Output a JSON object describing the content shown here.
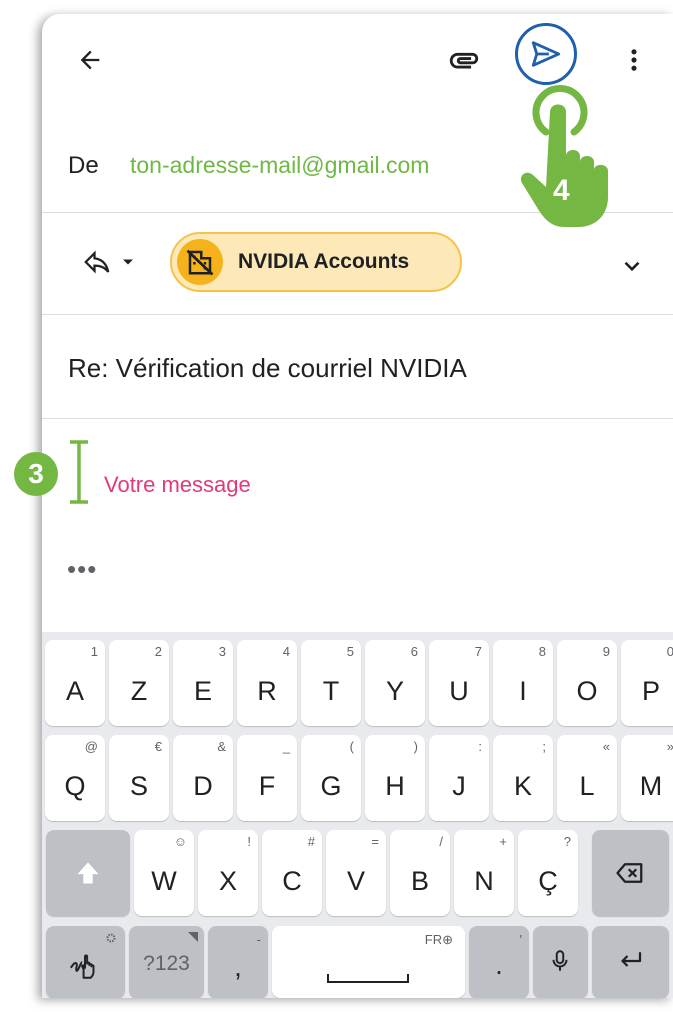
{
  "compose": {
    "from_label": "De",
    "from_value": "ton-adresse-mail@gmail.com",
    "recipient_chip": "NVIDIA Accounts",
    "subject": "Re: Vérification de courriel NVIDIA",
    "body_placeholder": "Votre message",
    "quoted_ellipsis": "•••"
  },
  "annotations": {
    "step_3": "3",
    "step_4": "4"
  },
  "icons": {
    "back": "arrow-left-icon",
    "attach": "paperclip-icon",
    "send": "send-icon",
    "more": "more-vert-icon",
    "reply": "reply-icon",
    "dropdown": "caret-down-icon",
    "expand": "chevron-down-icon",
    "avatar": "no-building-icon",
    "tap": "hand-pointer-icon"
  },
  "colors": {
    "accent_green": "#74b843",
    "send_blue": "#1f5fae",
    "placeholder_pink": "#e2397c",
    "chip_fill": "#fde9b8",
    "chip_border": "#f5c34d",
    "avatar_yellow": "#f6b21a"
  },
  "keyboard": {
    "row1": [
      {
        "main": "A",
        "hint": "1"
      },
      {
        "main": "Z",
        "hint": "2"
      },
      {
        "main": "E",
        "hint": "3"
      },
      {
        "main": "R",
        "hint": "4"
      },
      {
        "main": "T",
        "hint": "5"
      },
      {
        "main": "Y",
        "hint": "6"
      },
      {
        "main": "U",
        "hint": "7"
      },
      {
        "main": "I",
        "hint": "8"
      },
      {
        "main": "O",
        "hint": "9"
      },
      {
        "main": "P",
        "hint": "0"
      }
    ],
    "row2": [
      {
        "main": "Q",
        "hint": "@"
      },
      {
        "main": "S",
        "hint": "€"
      },
      {
        "main": "D",
        "hint": "&"
      },
      {
        "main": "F",
        "hint": "_"
      },
      {
        "main": "G",
        "hint": "("
      },
      {
        "main": "H",
        "hint": ")"
      },
      {
        "main": "J",
        "hint": ":"
      },
      {
        "main": "K",
        "hint": ";"
      },
      {
        "main": "L",
        "hint": "«"
      },
      {
        "main": "M",
        "hint": "»"
      }
    ],
    "row3": [
      {
        "main": "W",
        "hint": "☺"
      },
      {
        "main": "X",
        "hint": "!"
      },
      {
        "main": "C",
        "hint": "#"
      },
      {
        "main": "V",
        "hint": "="
      },
      {
        "main": "B",
        "hint": "/"
      },
      {
        "main": "N",
        "hint": "+"
      },
      {
        "main": "Ç",
        "hint": "?"
      }
    ],
    "symbols_label": "?123",
    "comma_main": ",",
    "comma_hint": "-",
    "space_hint": "FR⊕",
    "period_main": ".",
    "period_hint": "'"
  }
}
